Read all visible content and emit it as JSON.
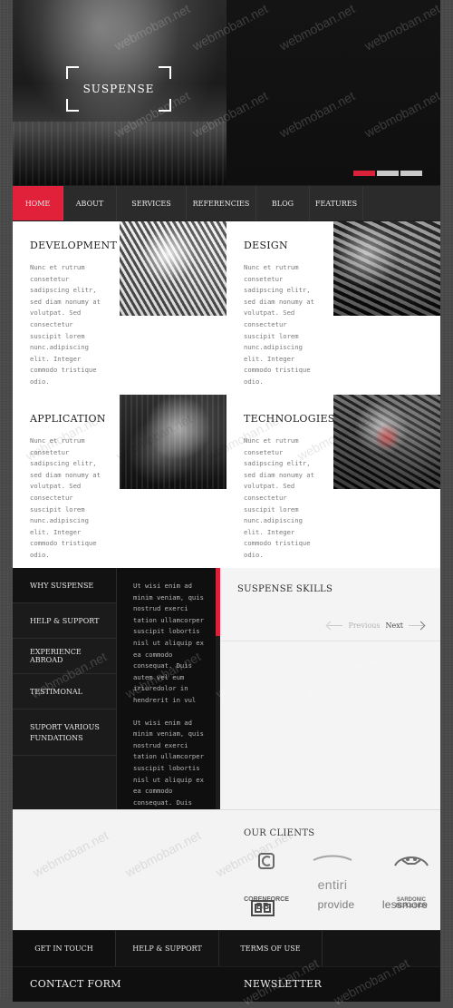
{
  "hero": {
    "title": "SUSPENSE",
    "slider": {
      "dots": [
        {
          "active": true
        },
        {
          "active": false
        },
        {
          "active": false
        }
      ]
    },
    "watermark": "webmoban.net"
  },
  "nav": {
    "items": [
      {
        "label": "HOME",
        "active": true
      },
      {
        "label": "ABOUT",
        "active": false
      },
      {
        "label": "SERVICES",
        "active": false
      },
      {
        "label": "REFERENCIES",
        "active": false
      },
      {
        "label": "BLOG",
        "active": false
      },
      {
        "label": "FEATURES",
        "active": false
      }
    ]
  },
  "features": [
    {
      "title": "DEVELOPMENT",
      "text": "Nunc et rutrum\nconsetetur\nsadipscing elitr,\nsed diam nonumy at\nvolutpat. Sed\nconsectetur\nsuscipit lorem\nnunc.adipiscing\nelit. Integer\ncommodo tristique\nodio."
    },
    {
      "title": "DESIGN",
      "text": "Nunc et rutrum\nconsetetur\nsadipscing elitr,\nsed diam nonumy at\nvolutpat. Sed\nconsectetur\nsuscipit lorem\nnunc.adipiscing\nelit. Integer\ncommodo tristique\nodio."
    },
    {
      "title": "APPLICATION",
      "text": "Nunc et rutrum\nconsetetur\nsadipscing elitr,\nsed diam nonumy at\nvolutpat. Sed\nconsectetur\nsuscipit lorem\nnunc.adipiscing\nelit. Integer\ncommodo tristique\nodio."
    },
    {
      "title": "TECHNOLOGIES",
      "text": "Nunc et rutrum\nconsetetur\nsadipscing elitr,\nsed diam nonumy at\nvolutpat. Sed\nconsectetur\nsuscipit lorem\nnunc.adipiscing\nelit. Integer\ncommodo tristique\nodio."
    }
  ],
  "panel": {
    "menu": [
      {
        "label": "WHY SUSPENSE",
        "active": true
      },
      {
        "label": "HELP & SUPPORT",
        "active": false
      },
      {
        "label": "EXPERIENCE ABROAD",
        "active": false
      },
      {
        "label": "TESTIMONAL",
        "active": false
      },
      {
        "label": "SUPORT VARIOUS\nFUNDATIONS",
        "active": false
      }
    ],
    "text": [
      "Ut wisi enim ad\nminim veniam, quis\nnostrud exerci\ntation ullamcorper\nsuscipit lobortis\nnisl ut aliquip ex\nea commodo\nconsequat. Duis\nautem vel eum\niriuredolor in\nhendrerit in vul",
      "Ut wisi enim ad\nminim veniam, quis\nnostrud exerci\ntation ullamcorper\nsuscipit lobortis\nnisl ut aliquip ex\nea commodo\nconsequat. Duis"
    ],
    "skills": {
      "title": "SUSPENSE SKILLS",
      "previous": "Previous",
      "next": "Next"
    }
  },
  "clients": {
    "title": "OUR CLIENTS",
    "logos": [
      {
        "name": "CORENFORCE"
      },
      {
        "name": "entiri"
      },
      {
        "name": "SARDONIC\nREPULSION"
      },
      {
        "name": "BB"
      },
      {
        "name": "provide"
      },
      {
        "name": "lessmore"
      }
    ]
  },
  "footer": {
    "tabs": [
      {
        "label": "GET IN TOUCH",
        "active": true
      },
      {
        "label": "HELP & SUPPORT",
        "active": false
      },
      {
        "label": "TERMS OF USE",
        "active": false
      }
    ],
    "headings": {
      "left": "CONTACT FORM",
      "right": "NEWSLETTER"
    }
  },
  "colors": {
    "accent": "#e1213a",
    "dark": "#111111",
    "mid": "#2b2b2b",
    "light": "#f4f4f4"
  }
}
